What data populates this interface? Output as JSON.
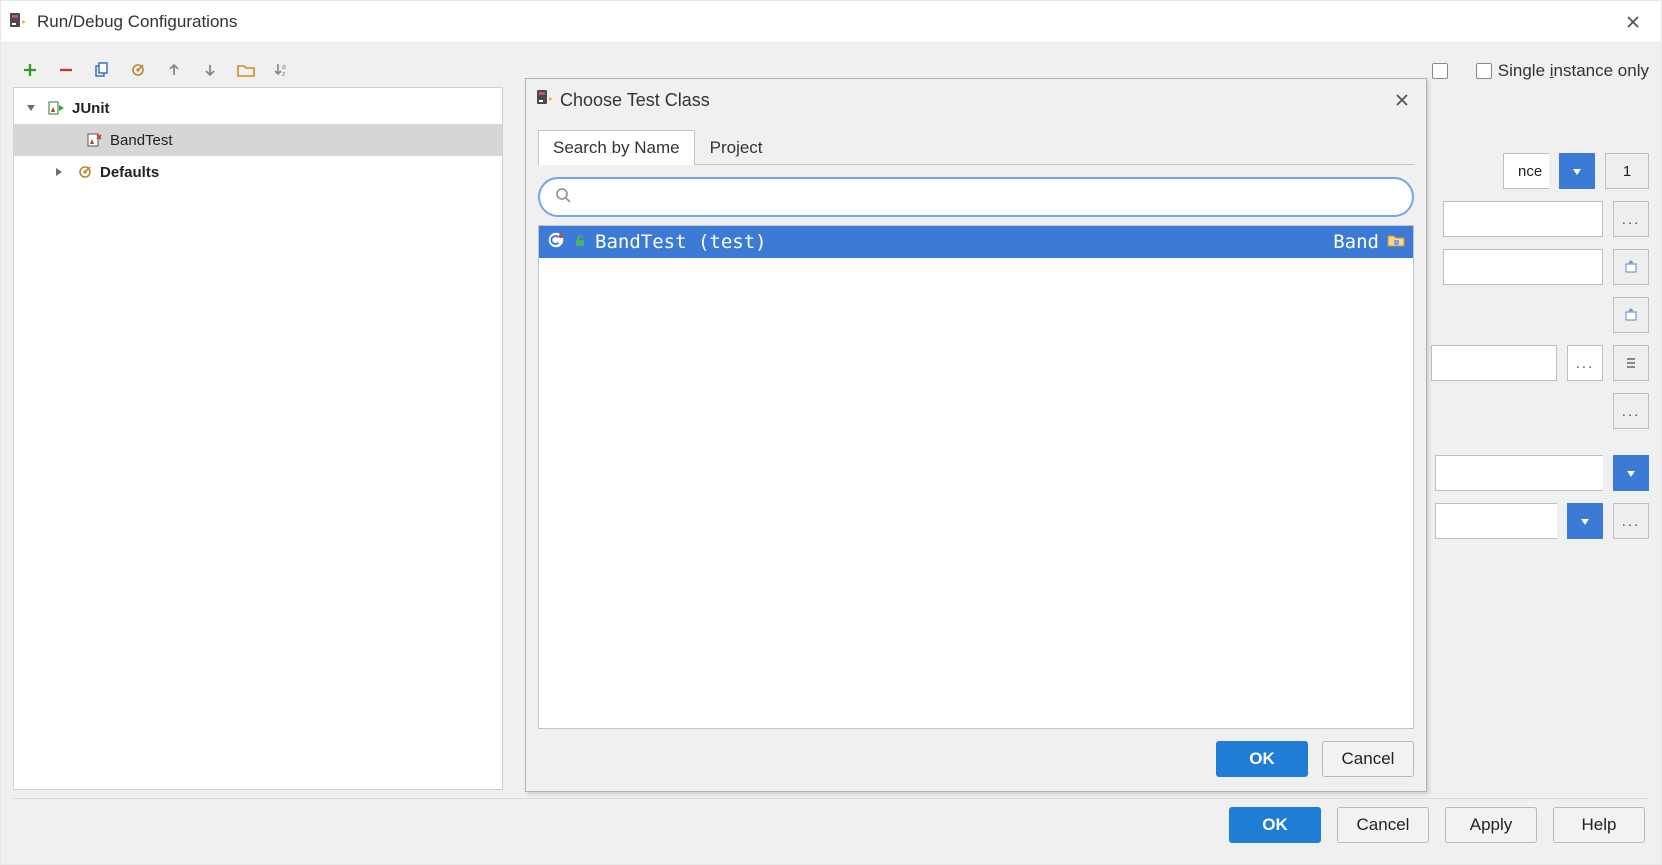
{
  "main_window": {
    "title": "Run/Debug Configurations"
  },
  "checkboxes": {
    "single_instance_label_pre": "Single ",
    "single_instance_label_u": "i",
    "single_instance_label_post": "nstance only"
  },
  "tree": {
    "junit_label": "JUnit",
    "bandtest_label": "BandTest",
    "defaults_label": "Defaults"
  },
  "right": {
    "combo_trailing_text": "nce",
    "fork_count": "1"
  },
  "dialog": {
    "title": "Choose Test Class",
    "tabs": {
      "search_by_name": "Search by Name",
      "project": "Project"
    },
    "result_text": "BandTest (test)",
    "result_module": "Band"
  },
  "buttons": {
    "ok": "OK",
    "cancel": "Cancel",
    "apply": "Apply",
    "help": "Help"
  }
}
